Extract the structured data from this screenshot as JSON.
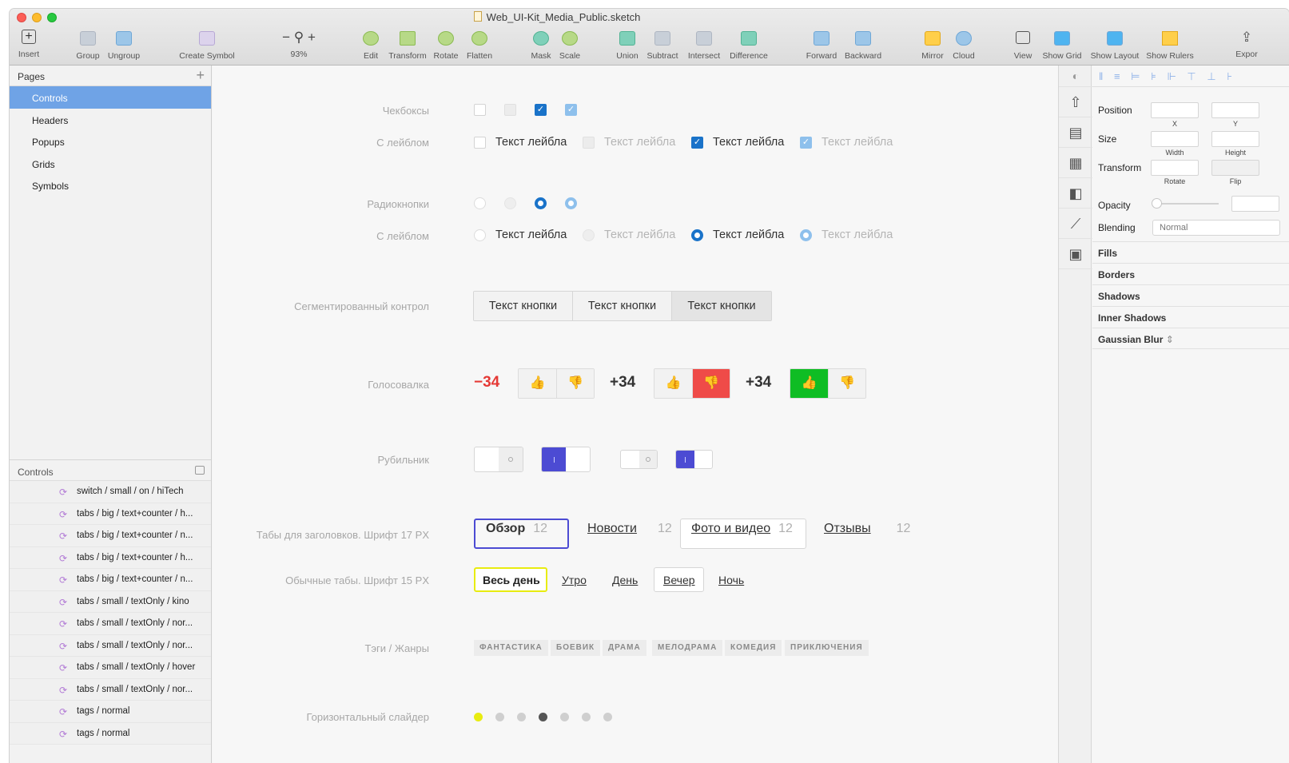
{
  "window": {
    "title": "Web_UI-Kit_Media_Public.sketch"
  },
  "toolbar": {
    "insert": "Insert",
    "group": "Group",
    "ungroup": "Ungroup",
    "create_symbol": "Create Symbol",
    "zoom": "93%",
    "zoom_minus": "−",
    "zoom_plus": "+",
    "edit": "Edit",
    "transform": "Transform",
    "rotate": "Rotate",
    "flatten": "Flatten",
    "mask": "Mask",
    "scale": "Scale",
    "union": "Union",
    "subtract": "Subtract",
    "intersect": "Intersect",
    "difference": "Difference",
    "forward": "Forward",
    "backward": "Backward",
    "mirror": "Mirror",
    "cloud": "Cloud",
    "view": "View",
    "show_grid": "Show Grid",
    "show_layout": "Show Layout",
    "show_rulers": "Show Rulers",
    "export": "Expor"
  },
  "pages": {
    "header": "Pages",
    "items": [
      {
        "label": "Controls"
      },
      {
        "label": "Headers"
      },
      {
        "label": "Popups"
      },
      {
        "label": "Grids"
      },
      {
        "label": "Symbols"
      }
    ]
  },
  "layers": {
    "header": "Controls",
    "items": [
      "switch / small / on / hiTech",
      "tabs / big / text+counter / h...",
      "tabs / big / text+counter / n...",
      "tabs / big / text+counter / h...",
      "tabs / big / text+counter / n...",
      "tabs / small / textOnly / kino",
      "tabs / small / textOnly / nor...",
      "tabs / small / textOnly / nor...",
      "tabs / small / textOnly / hover",
      "tabs / small / textOnly / nor...",
      "tags / normal",
      "tags / normal"
    ]
  },
  "canvas": {
    "labels": {
      "checkboxes": "Чекбоксы",
      "checkboxes_labeled": "С лейблом",
      "radios": "Радиокнопки",
      "radios_labeled": "С лейблом",
      "segmented": "Сегментированный контрол",
      "voting": "Голосовалка",
      "switch": "Рубильник",
      "tabs_headers": "Табы для заголовков. Шрифт 17 PX",
      "tabs_regular": "Обычные табы. Шрифт 15 PX",
      "tags": "Тэги / Жанры",
      "slider": "Горизонтальный слайдер"
    },
    "label_text": "Текст лейбла",
    "segment_text": "Текст кнопки",
    "votes": {
      "neg": "−34",
      "pos1": "+34",
      "pos2": "+34"
    },
    "header_tabs": {
      "t1": "Обзор",
      "t2": "Новости",
      "t3": "Фото и видео",
      "t4": "Отзывы",
      "count": "12"
    },
    "small_tabs": {
      "t1": "Весь день",
      "t2": "Утро",
      "t3": "День",
      "t4": "Вечер",
      "t5": "Ночь"
    },
    "tags": [
      "ФАНТАСТИКА",
      "БОЕВИК",
      "ДРАМА",
      "МЕЛОДРАМА",
      "КОМЕДИЯ",
      "ПРИКЛЮЧЕНИЯ"
    ],
    "slider": {
      "dots": 7,
      "active_index": 0,
      "current_index": 3
    }
  },
  "inspector": {
    "position": "Position",
    "x": "X",
    "y": "Y",
    "size": "Size",
    "width": "Width",
    "height": "Height",
    "transform": "Transform",
    "rotate": "Rotate",
    "flip": "Flip",
    "opacity": "Opacity",
    "blending": "Blending",
    "blending_value": "Normal",
    "fills": "Fills",
    "borders": "Borders",
    "shadows": "Shadows",
    "inner_shadows": "Inner Shadows",
    "gaussian_blur": "Gaussian Blur"
  },
  "colors": {
    "accent_blue": "#1a73c9",
    "page_selected": "#6fa3e6",
    "vote_red": "#ef4b48",
    "vote_green": "#0fbd24",
    "switch_on": "#4c4bd3",
    "tab_header_border": "#4c4bd3",
    "tab_small_border": "#e8ec10"
  }
}
